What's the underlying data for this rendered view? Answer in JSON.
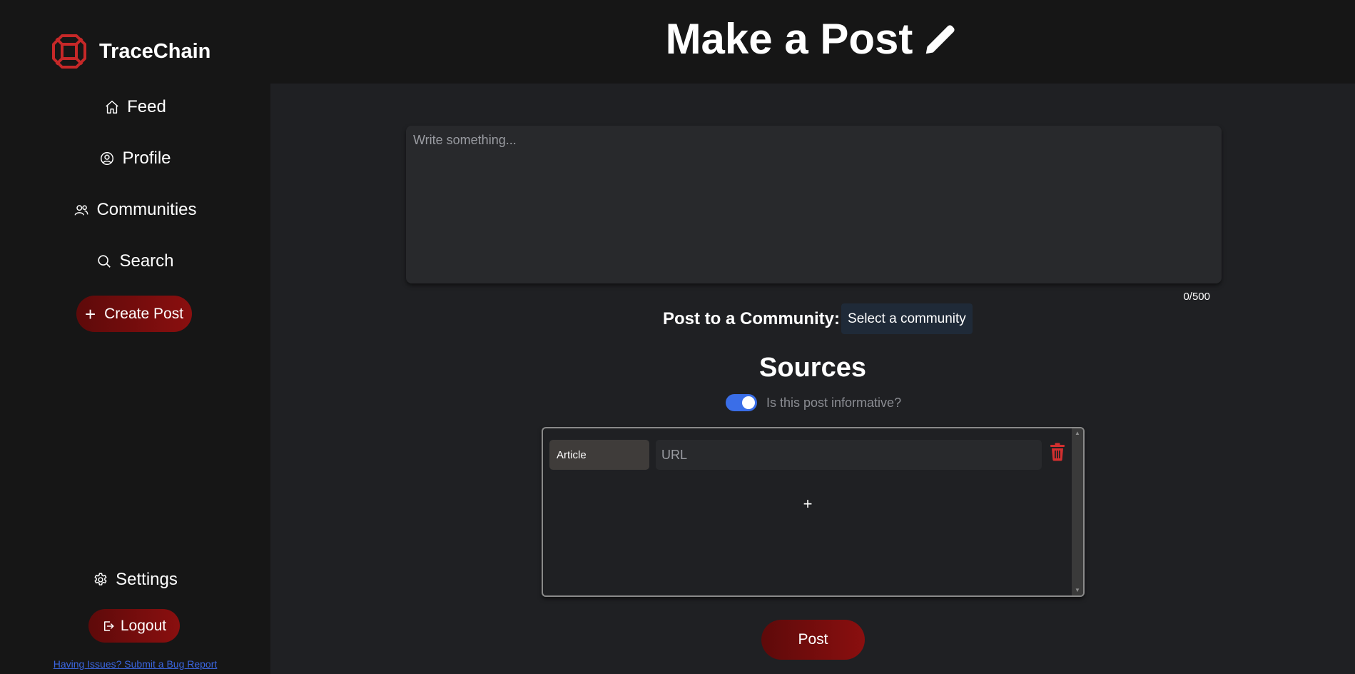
{
  "brand": {
    "name": "TraceChain",
    "logo_icon": "tracechain-logo-icon",
    "accent": "#c62828"
  },
  "sidebar": {
    "items": [
      {
        "label": "Feed",
        "icon": "home-icon"
      },
      {
        "label": "Profile",
        "icon": "user-circle-icon"
      },
      {
        "label": "Communities",
        "icon": "users-icon"
      },
      {
        "label": "Search",
        "icon": "search-icon"
      }
    ],
    "create_post": {
      "label": "Create Post",
      "icon": "plus-icon"
    },
    "settings": {
      "label": "Settings",
      "icon": "gear-icon"
    },
    "logout": {
      "label": "Logout",
      "icon": "logout-icon"
    },
    "bug_report": "Having Issues? Submit a Bug Report"
  },
  "header": {
    "title": "Make a Post",
    "icon": "pencil-icon"
  },
  "composer": {
    "placeholder": "Write something...",
    "value": "",
    "char_count": "0/500"
  },
  "community": {
    "label": "Post to a Community:",
    "selected": "Select a community"
  },
  "sources": {
    "title": "Sources",
    "informative_toggle": {
      "label": "Is this post informative?",
      "on": true
    },
    "rows": [
      {
        "type": "Article",
        "url_placeholder": "URL",
        "url_value": ""
      }
    ],
    "add_label": "+"
  },
  "post_button": {
    "label": "Post"
  },
  "colors": {
    "sidebar_bg": "#161616",
    "main_bg": "#1f2023",
    "button_red": "#8a0f0f",
    "toggle_blue": "#3a6ee8",
    "link_blue": "#3b66e0"
  }
}
